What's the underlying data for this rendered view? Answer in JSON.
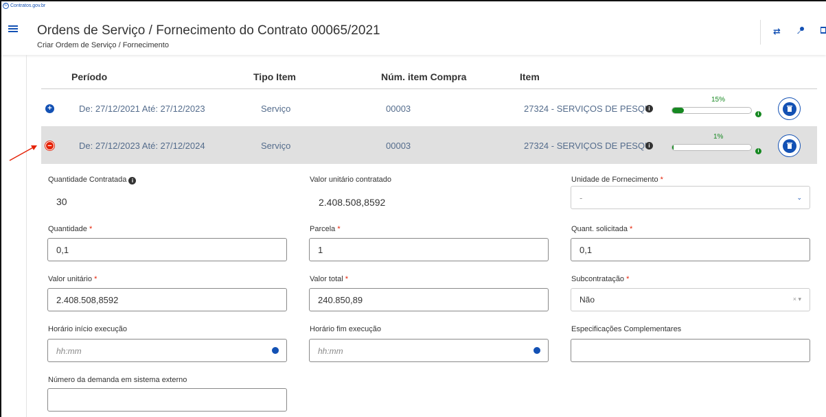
{
  "brand": {
    "logo_text": "Contratos.gov.br"
  },
  "header": {
    "title": "Ordens de Serviço / Fornecimento do Contrato 00065/2021",
    "subtitle": "Criar Ordem de Serviço / Fornecimento",
    "icons": [
      "menu-icon",
      "swap-icon",
      "key-icon",
      "logout-icon"
    ]
  },
  "table": {
    "columns": [
      "Período",
      "Tipo Item",
      "Núm. item Compra",
      "Item"
    ],
    "rows": [
      {
        "toggle": "+",
        "periodo": "De: 27/12/2021 Até: 27/12/2023",
        "tipo": "Serviço",
        "num": "00003",
        "item": "27324 - SERVIÇOS DE PESQU",
        "progress_label": "15%",
        "progress_value": 0.15,
        "expanded": false
      },
      {
        "toggle": "−",
        "periodo": "De: 27/12/2023 Até: 27/12/2024",
        "tipo": "Serviço",
        "num": "00003",
        "item": "27324 - SERVIÇOS DE PESQU",
        "progress_label": "1%",
        "progress_value": 0.01,
        "expanded": true
      }
    ]
  },
  "form": {
    "quantidade_contratada": {
      "label": "Quantidade Contratada",
      "value": "30"
    },
    "valor_unitario_contratado": {
      "label": "Valor unitário contratado",
      "value": "2.408.508,8592"
    },
    "unidade_fornecimento": {
      "label": "Unidade de Fornecimento",
      "value": "-"
    },
    "quantidade": {
      "label": "Quantidade",
      "value": "0,1"
    },
    "parcela": {
      "label": "Parcela",
      "value": "1"
    },
    "quant_solicitada": {
      "label": "Quant. solicitada",
      "value": "0,1"
    },
    "valor_unitario": {
      "label": "Valor unitário",
      "value": "2.408.508,8592"
    },
    "valor_total": {
      "label": "Valor total",
      "value": "240.850,89"
    },
    "subcontratacao": {
      "label": "Subcontratação",
      "value": "Não"
    },
    "horario_inicio": {
      "label": "Horário início execução",
      "placeholder": "hh:mm"
    },
    "horario_fim": {
      "label": "Horário fim execução",
      "placeholder": "hh:mm"
    },
    "especificacoes": {
      "label": "Especificações Complementares",
      "value": ""
    },
    "numero_demanda": {
      "label": "Número da demanda em sistema externo",
      "value": ""
    },
    "required_mark": "*"
  },
  "colors": {
    "primary": "#1351b4",
    "danger": "#e52207",
    "success": "#168821",
    "expanded_row": "#e0e0e0"
  }
}
